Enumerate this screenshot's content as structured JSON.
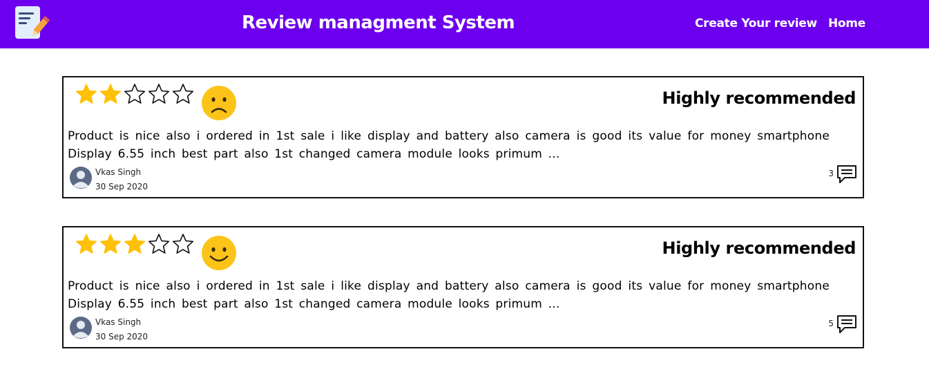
{
  "header": {
    "title": "Review managment System",
    "nav": {
      "create_label": "Create Your review",
      "home_label": "Home"
    },
    "bg_color": "#6c00ee",
    "logo_icon": "notepad-pencil-icon"
  },
  "reviews": [
    {
      "rating": 2,
      "max_rating": 5,
      "mood_icon": "sad-face-icon",
      "recommendation": "Highly recommended",
      "text": "Product is nice also i ordered in 1st sale i like display and battery also camera is good its value for money smartphone Display 6.55 inch best part also 1st changed camera module looks primum ...",
      "author": "Vkas Singh",
      "date": "30 Sep 2020",
      "comment_count": "3"
    },
    {
      "rating": 3,
      "max_rating": 5,
      "mood_icon": "smiley-face-icon",
      "recommendation": "Highly recommended",
      "text": "Product is nice also i ordered in 1st sale i like display and battery also camera is good its value for money smartphone Display 6.55 inch best part also 1st changed camera module looks primum ...",
      "author": "Vkas Singh",
      "date": "30 Sep 2020",
      "comment_count": "5"
    }
  ],
  "colors": {
    "star_filled": "#ffc107",
    "face": "#fcc419"
  }
}
